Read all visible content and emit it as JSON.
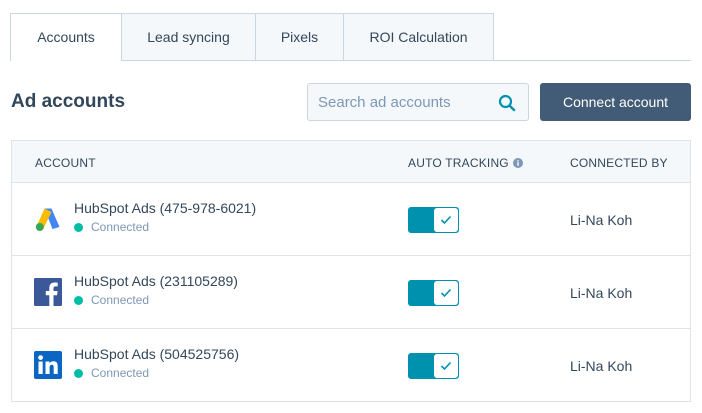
{
  "tabs": [
    {
      "label": "Accounts",
      "active": true
    },
    {
      "label": "Lead syncing",
      "active": false
    },
    {
      "label": "Pixels",
      "active": false
    },
    {
      "label": "ROI Calculation",
      "active": false
    }
  ],
  "header": {
    "title": "Ad accounts",
    "search_placeholder": "Search ad accounts",
    "connect_label": "Connect account"
  },
  "table": {
    "columns": {
      "account": "ACCOUNT",
      "auto_tracking": "AUTO TRACKING",
      "connected_by": "CONNECTED BY"
    },
    "rows": [
      {
        "platform": "google-ads",
        "name": "HubSpot Ads (475-978-6021)",
        "status": "Connected",
        "auto_tracking": true,
        "connected_by": "Li-Na Koh"
      },
      {
        "platform": "facebook",
        "name": "HubSpot Ads (231105289)",
        "status": "Connected",
        "auto_tracking": true,
        "connected_by": "Li-Na Koh"
      },
      {
        "platform": "linkedin",
        "name": "HubSpot Ads (504525756)",
        "status": "Connected",
        "auto_tracking": true,
        "connected_by": "Li-Na Koh"
      }
    ]
  },
  "colors": {
    "primary_button": "#425b76",
    "toggle_on": "#0091ae",
    "status_connected": "#00bda5",
    "text": "#33475b"
  }
}
